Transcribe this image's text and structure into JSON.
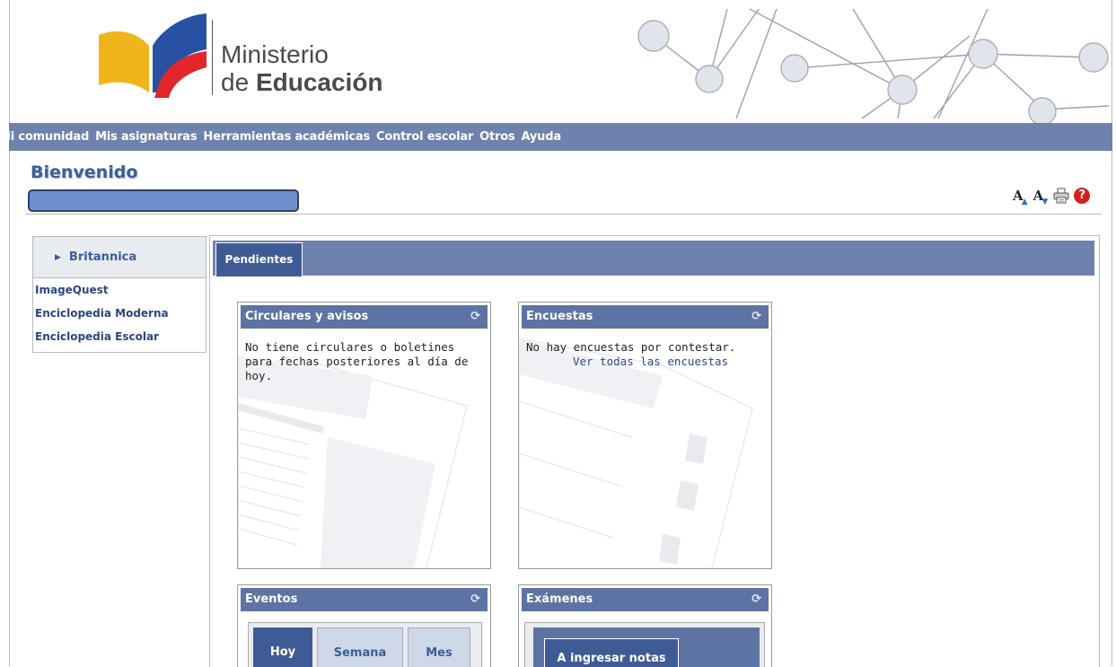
{
  "brand": {
    "line1": "Ministerio",
    "line2_prefix": "de ",
    "line2_bold": "Educación",
    "colors": {
      "yellow": "#f0b51b",
      "blue": "#2851a3",
      "red": "#e1262c",
      "nav": "#6f82ad",
      "tab_active": "#3f5b96"
    }
  },
  "nav": {
    "items": [
      "Mi comunidad",
      "Mis asignaturas",
      "Herramientas académicas",
      "Control escolar",
      "Otros",
      "Ayuda"
    ]
  },
  "welcome": {
    "title": "Bienvenido"
  },
  "tools": {
    "font_increase_icon": "A",
    "font_decrease_icon": "A",
    "print_icon": "printer-icon",
    "help_icon": "?"
  },
  "sidebar": {
    "header": "Britannica",
    "links": [
      "ImageQuest",
      "Enciclopedia Moderna",
      "Enciclopedia Escolar"
    ]
  },
  "main": {
    "tab_label": "Pendientes"
  },
  "widgets": {
    "circulares": {
      "title": "Circulares y avisos",
      "text": "No tiene circulares o boletines para fechas posteriores al día de hoy."
    },
    "encuestas": {
      "title": "Encuestas",
      "text": "No hay encuestas por contestar.",
      "link": "Ver todas las encuestas"
    },
    "eventos": {
      "title": "Eventos",
      "tabs": [
        "Hoy",
        "Semana",
        "Mes"
      ]
    },
    "examenes": {
      "title": "Exámenes",
      "button": "A ingresar notas"
    }
  }
}
